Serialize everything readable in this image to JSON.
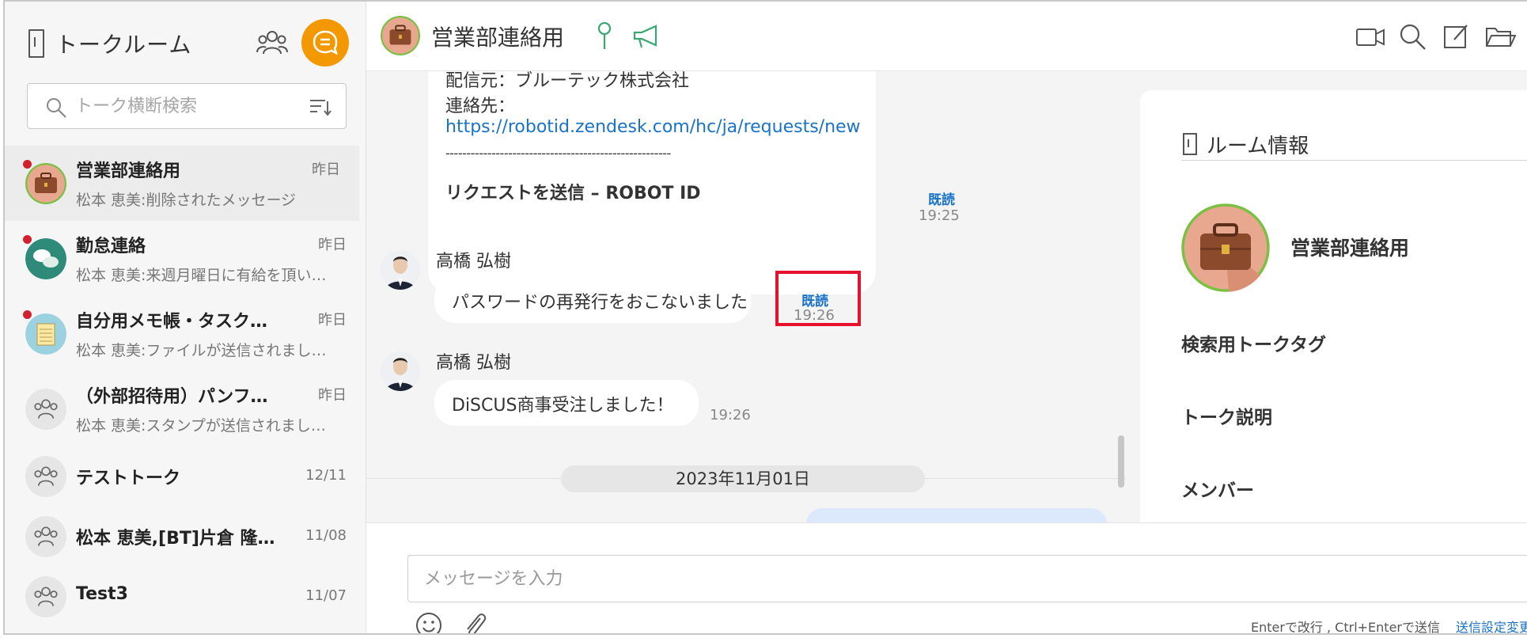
{
  "sidebar": {
    "title": "トークルーム",
    "search_placeholder": "トーク横断検索",
    "rooms": [
      {
        "name": "営業部連絡用",
        "date": "昨日",
        "preview": "松本 恵美:削除されたメッセージ"
      },
      {
        "name": "勤怠連絡",
        "date": "昨日",
        "preview": "松本 恵美:来週月曜日に有給を頂い…"
      },
      {
        "name": "自分用メモ帳・タスク…",
        "date": "昨日",
        "preview": "松本 恵美:ファイルが送信されまし…"
      },
      {
        "name": "（外部招待用）パンフ…",
        "date": "昨日",
        "preview": "松本 恵美:スタンプが送信されまし…"
      },
      {
        "name": "テストトーク",
        "date": "12/11"
      },
      {
        "name": "松本 恵美,[BT]片倉 隆…",
        "date": "11/08"
      },
      {
        "name": "Test3",
        "date": "11/07"
      }
    ]
  },
  "chat": {
    "title": "営業部連絡用",
    "messages": {
      "first_lines": [
        "配信元：ブルーテック株式会社",
        "連絡先：",
        "https://robotid.zendesk.com/hc/ja/requests/new",
        "------------------------------------------------------",
        "リクエストを送信 – ROBOT ID"
      ],
      "first_read": "既読",
      "first_time": "19:25",
      "second_sender": "高橋 弘樹",
      "second_text": "パスワードの再発行をおこないました",
      "second_read": "既読",
      "second_time": "19:26",
      "third_sender": "高橋 弘樹",
      "third_text": "DiSCUS商事受注しました！",
      "third_time": "19:26",
      "date_divider": "2023年11月01日"
    }
  },
  "room_info": {
    "title": "ルーム情報",
    "room_name": "営業部連絡用",
    "labels": [
      "検索用トークタグ",
      "トーク説明",
      "メンバー"
    ]
  },
  "composer": {
    "placeholder": "メッセージを入力",
    "hint": "Enterで改行 , Ctrl+Enterで送信",
    "send_setting": "送信設定変更"
  },
  "colors": {
    "accent_orange": "#f39800",
    "link_blue": "#1a73c7",
    "highlight_red": "#e8112d",
    "unread_red": "#d0212f"
  }
}
